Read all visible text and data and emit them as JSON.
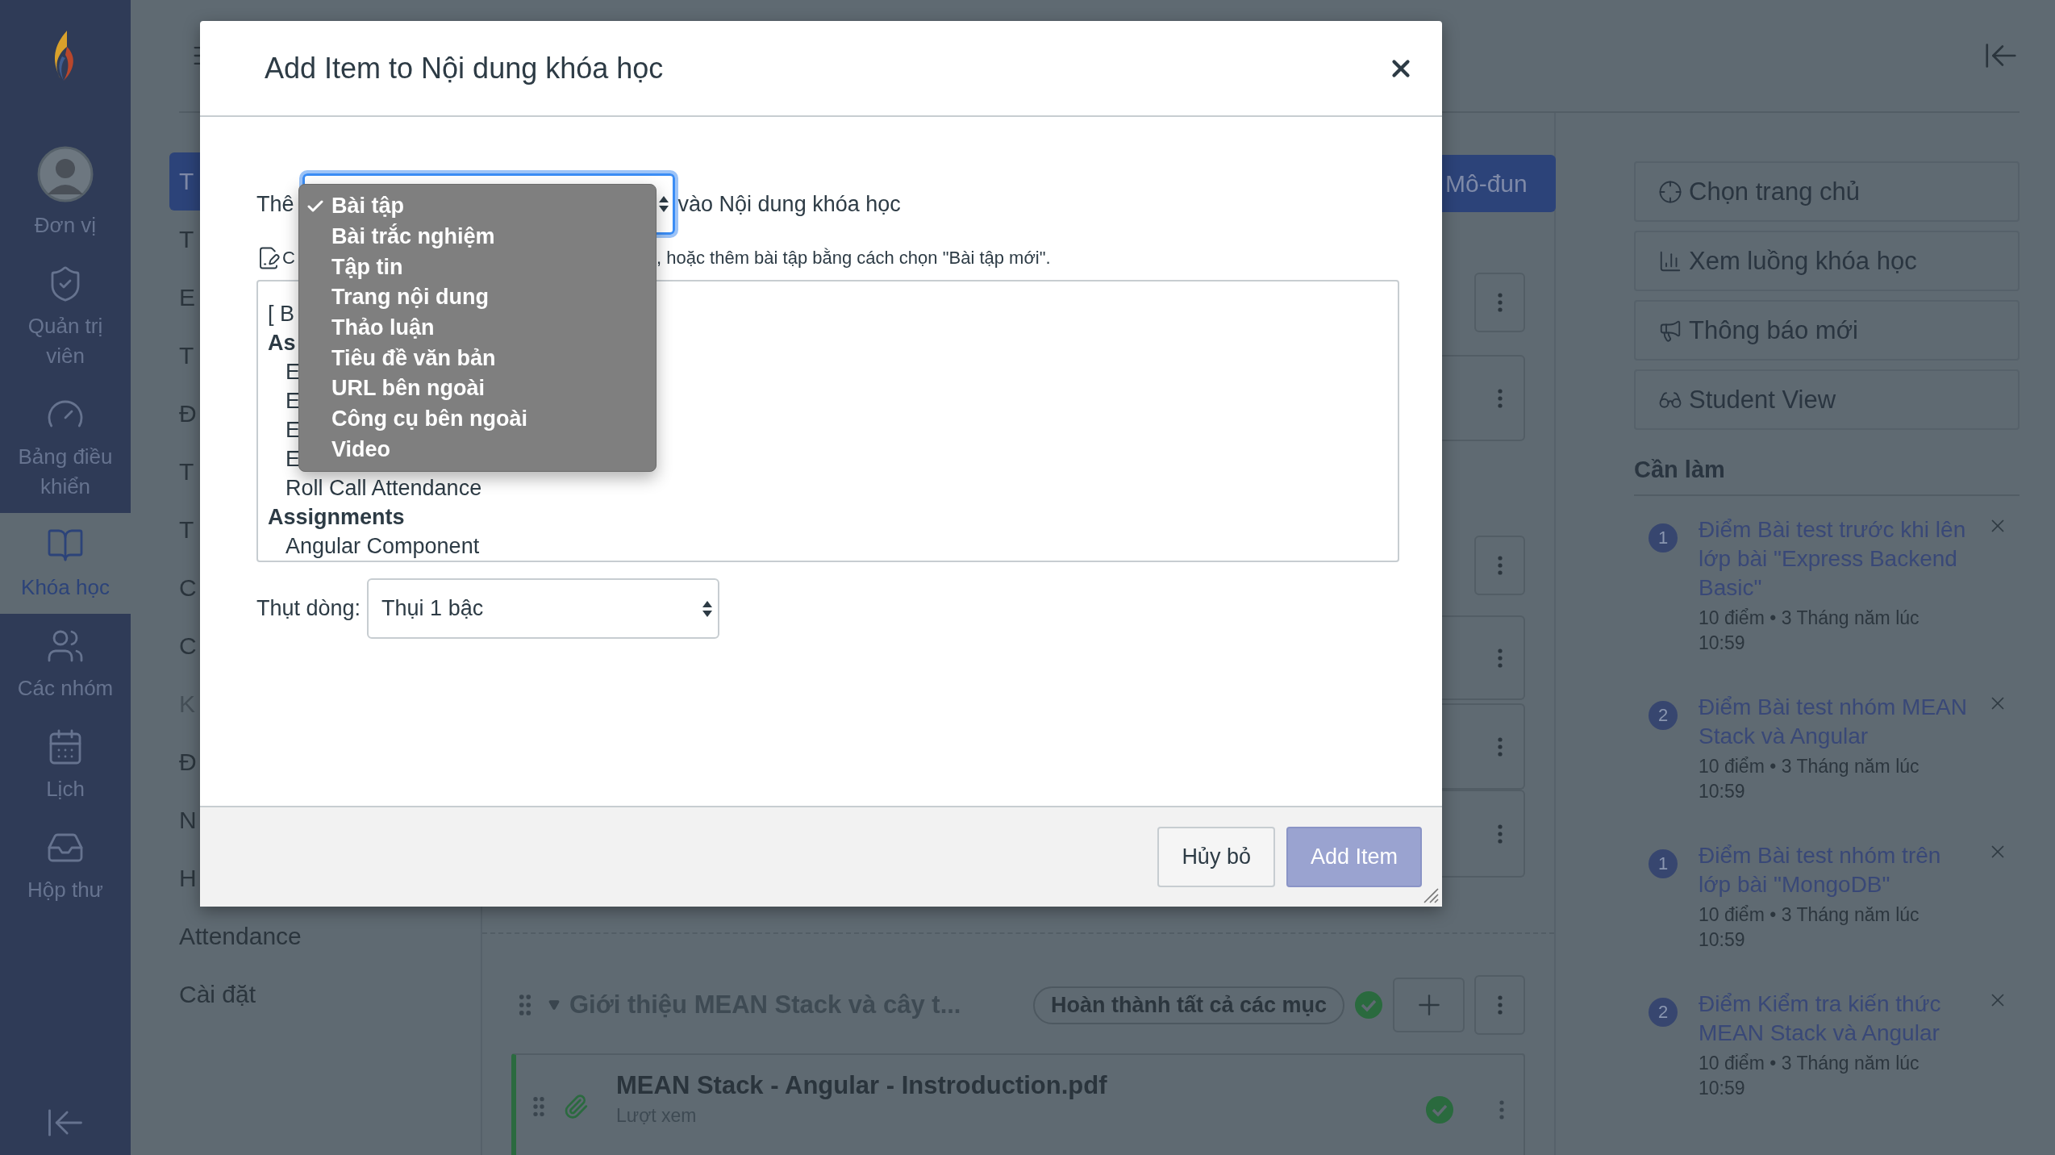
{
  "global_nav": {
    "items": [
      {
        "kind": "avatar",
        "label": "Đơn vị",
        "selected": false
      },
      {
        "kind": "shield",
        "label": "Quản trị viên",
        "selected": false
      },
      {
        "kind": "gauge",
        "label": "Bảng điều khiển",
        "selected": false
      },
      {
        "kind": "book",
        "label": "Khóa học",
        "selected": true
      },
      {
        "kind": "users",
        "label": "Các nhóm",
        "selected": false
      },
      {
        "kind": "calendar",
        "label": "Lịch",
        "selected": false
      },
      {
        "kind": "inbox",
        "label": "Hộp thư",
        "selected": false
      }
    ]
  },
  "course_nav": {
    "items": [
      {
        "label": "T",
        "selected": true,
        "disabled": false
      },
      {
        "label": "T",
        "selected": false,
        "disabled": false
      },
      {
        "label": "E",
        "selected": false,
        "disabled": false
      },
      {
        "label": "T",
        "selected": false,
        "disabled": false
      },
      {
        "label": "Đ",
        "selected": false,
        "disabled": false
      },
      {
        "label": "T",
        "selected": false,
        "disabled": false
      },
      {
        "label": "T",
        "selected": false,
        "disabled": false
      },
      {
        "label": "C",
        "selected": false,
        "disabled": false
      },
      {
        "label": "C",
        "selected": false,
        "disabled": false
      },
      {
        "label": "K",
        "selected": false,
        "disabled": true
      },
      {
        "label": "Đ",
        "selected": false,
        "disabled": false
      },
      {
        "label": "N",
        "selected": false,
        "disabled": false
      },
      {
        "label": "H",
        "selected": false,
        "disabled": false
      },
      {
        "label": "Attendance",
        "selected": false,
        "disabled": false
      },
      {
        "label": "Cài đặt",
        "selected": false,
        "disabled": false
      }
    ]
  },
  "modules": {
    "add_module_button": "Mô-đun",
    "section": {
      "title": "Giới thiệu MEAN Stack và cây t...",
      "requirement": "Hoàn thành tất cả các mục",
      "completed": true
    },
    "item": {
      "title": "MEAN Stack - Angular - Instroduction.pdf",
      "subtitle": "Lượt xem",
      "completed": true
    }
  },
  "sidebar": {
    "buttons": [
      {
        "kind": "home",
        "label": "Chọn trang chủ"
      },
      {
        "kind": "stream",
        "label": "Xem luồng khóa học"
      },
      {
        "kind": "announce",
        "label": "Thông báo mới"
      },
      {
        "kind": "student",
        "label": "Student View"
      }
    ],
    "todo": {
      "title": "Cần làm",
      "items": [
        {
          "badge": "1",
          "title": "Điểm Bài test trước khi lên lớp bài \"Express Backend Basic\"",
          "meta": "10 điểm • 3 Tháng năm lúc 10:59"
        },
        {
          "badge": "2",
          "title": "Điểm Bài test nhóm MEAN Stack và Angular",
          "meta": "10 điểm • 3 Tháng năm lúc 10:59"
        },
        {
          "badge": "1",
          "title": "Điểm Bài test nhóm trên lớp bài \"MongoDB\"",
          "meta": "10 điểm • 3 Tháng năm lúc 10:59"
        },
        {
          "badge": "2",
          "title": "Điểm Kiểm tra kiến thức MEAN Stack và Angular",
          "meta": "10 điểm • 3 Tháng năm lúc 10:59"
        }
      ]
    }
  },
  "dialog": {
    "title": "Add Item to Nội dung khóa học",
    "add_label": "Thê",
    "type_select_focused": true,
    "after_label": "vào Nội dung khóa học",
    "hint_prefix": "C",
    "hint_suffix": ", hoặc thêm bài tập bằng cách chọn \"Bài tập mới\".",
    "list": [
      {
        "kind": "plain",
        "text": "[ B"
      },
      {
        "kind": "group",
        "text": "As"
      },
      {
        "kind": "option",
        "text": "E"
      },
      {
        "kind": "option",
        "text": "E"
      },
      {
        "kind": "option",
        "text": "E"
      },
      {
        "kind": "option",
        "text": "E"
      },
      {
        "kind": "option",
        "text": "Roll Call Attendance"
      },
      {
        "kind": "group",
        "text": "Assignments"
      },
      {
        "kind": "option",
        "text": "Angular Component"
      }
    ],
    "indent_label": "Thụt dòng:",
    "indent_value": "Thụi 1 bậc",
    "dropdown": [
      {
        "label": "Bài tập",
        "selected": true
      },
      {
        "label": "Bài trắc nghiệm",
        "selected": false
      },
      {
        "label": "Tập tin",
        "selected": false
      },
      {
        "label": "Trang nội dung",
        "selected": false
      },
      {
        "label": "Thảo luận",
        "selected": false
      },
      {
        "label": "Tiêu đề văn bản",
        "selected": false
      },
      {
        "label": "URL bên ngoài",
        "selected": false
      },
      {
        "label": "Công cụ bên ngoài",
        "selected": false
      },
      {
        "label": "Video",
        "selected": false
      }
    ],
    "buttons": [
      {
        "kind": "secondary",
        "label": "Hủy bỏ"
      },
      {
        "kind": "primary",
        "label": "Add Item"
      }
    ]
  }
}
